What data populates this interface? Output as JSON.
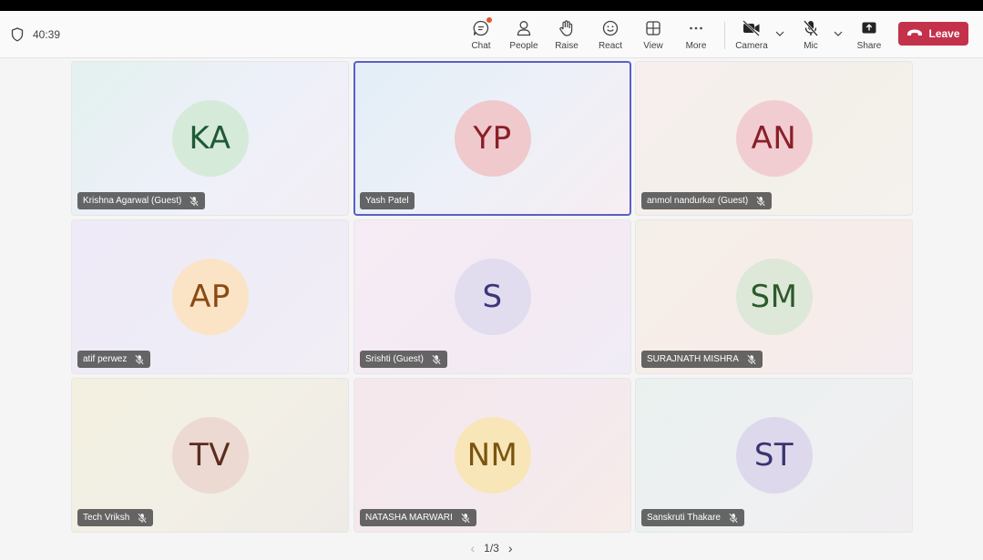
{
  "call": {
    "duration": "40:39"
  },
  "toolbar": {
    "chat_label": "Chat",
    "people_label": "People",
    "raise_label": "Raise",
    "react_label": "React",
    "view_label": "View",
    "more_label": "More",
    "camera_label": "Camera",
    "mic_label": "Mic",
    "share_label": "Share",
    "leave_label": "Leave",
    "leave_color": "#c4314b",
    "chat_badge_color": "#e3572b"
  },
  "participants": [
    {
      "initials": "KA",
      "name": "Krishna Agarwal (Guest)",
      "muted": true,
      "active": false,
      "avatar_bg": "#d6ead9",
      "avatar_fg": "#1e5a36"
    },
    {
      "initials": "YP",
      "name": "Yash Patel",
      "muted": false,
      "active": true,
      "avatar_bg": "#efc9cc",
      "avatar_fg": "#8a1f28"
    },
    {
      "initials": "AN",
      "name": "anmol nandurkar (Guest)",
      "muted": true,
      "active": false,
      "avatar_bg": "#f1cdd2",
      "avatar_fg": "#8a1f28"
    },
    {
      "initials": "AP",
      "name": "atif perwez",
      "muted": true,
      "active": false,
      "avatar_bg": "#fbe3c6",
      "avatar_fg": "#8a4a12"
    },
    {
      "initials": "S",
      "name": "Srishti (Guest)",
      "muted": true,
      "active": false,
      "avatar_bg": "#e2dcef",
      "avatar_fg": "#3c3778"
    },
    {
      "initials": "SM",
      "name": "SURAJNATH MISHRA",
      "muted": true,
      "active": false,
      "avatar_bg": "#dde8d8",
      "avatar_fg": "#2c5a2a"
    },
    {
      "initials": "TV",
      "name": "Tech Vriksh",
      "muted": true,
      "active": false,
      "avatar_bg": "#ebd9d2",
      "avatar_fg": "#5b2c1e"
    },
    {
      "initials": "NM",
      "name": "NATASHA MARWARI",
      "muted": true,
      "active": false,
      "avatar_bg": "#f8e5b8",
      "avatar_fg": "#7a5410"
    },
    {
      "initials": "ST",
      "name": "Sanskruti Thakare",
      "muted": true,
      "active": false,
      "avatar_bg": "#ddd8ec",
      "avatar_fg": "#3a3470"
    }
  ],
  "pagination": {
    "label": "1/3"
  }
}
